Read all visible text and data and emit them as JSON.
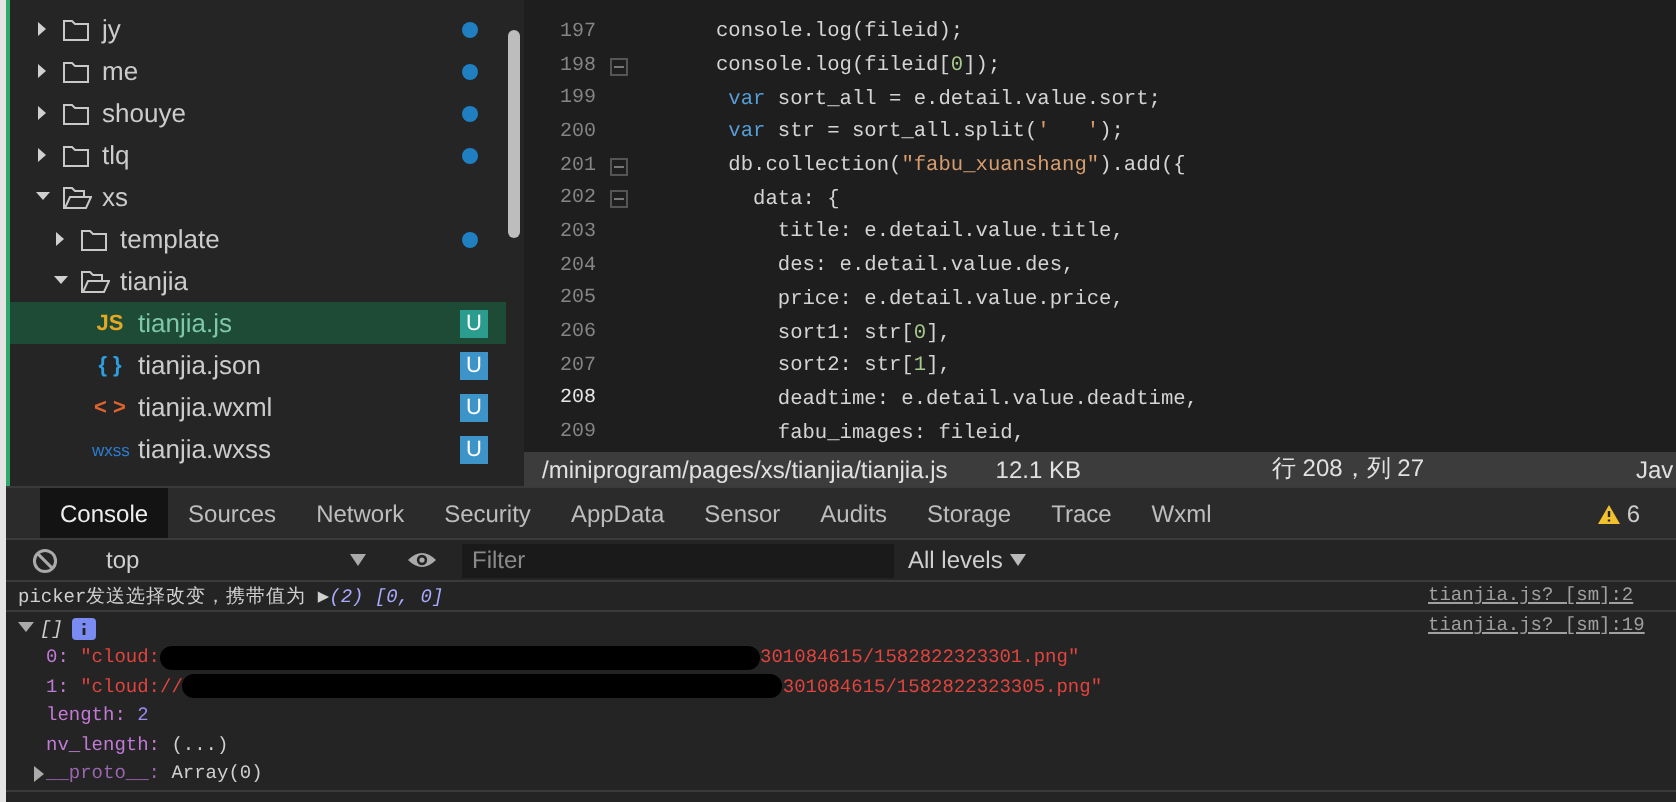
{
  "file_tree": {
    "items": [
      {
        "name": "jy",
        "kind": "folder",
        "expanded": false,
        "modified": true,
        "selected": false
      },
      {
        "name": "me",
        "kind": "folder",
        "expanded": false,
        "modified": true,
        "selected": false
      },
      {
        "name": "shouye",
        "kind": "folder",
        "expanded": false,
        "modified": true,
        "selected": false
      },
      {
        "name": "tlq",
        "kind": "folder",
        "expanded": false,
        "modified": true,
        "selected": false
      },
      {
        "name": "xs",
        "kind": "folder",
        "expanded": true,
        "modified": false,
        "selected": false,
        "children": [
          {
            "name": "template",
            "kind": "folder",
            "expanded": false,
            "modified": true,
            "selected": false
          },
          {
            "name": "tianjia",
            "kind": "folder",
            "expanded": true,
            "modified": false,
            "selected": false,
            "children": [
              {
                "name": "tianjia.js",
                "kind": "js",
                "icon": "JS",
                "badge": "U",
                "selected": true
              },
              {
                "name": "tianjia.json",
                "kind": "json",
                "icon": "{ }",
                "badge": "U",
                "selected": false
              },
              {
                "name": "tianjia.wxml",
                "kind": "wxml",
                "icon": "< >",
                "badge": "U",
                "selected": false
              },
              {
                "name": "tianjia.wxss",
                "kind": "wxss",
                "icon": "wxss",
                "badge": "U",
                "selected": false
              }
            ]
          }
        ]
      }
    ]
  },
  "editor": {
    "lines": [
      {
        "number": "197",
        "fold": false,
        "current": false,
        "tokens": [
          {
            "kind": "plain",
            "text": "console.log(fileid);"
          }
        ]
      },
      {
        "number": "198",
        "fold": true,
        "current": false,
        "tokens": [
          {
            "kind": "plain",
            "text": "console.log(fileid["
          },
          {
            "kind": "number",
            "text": "0"
          },
          {
            "kind": "plain",
            "text": "]);"
          }
        ]
      },
      {
        "number": "199",
        "fold": false,
        "current": false,
        "tokens": [
          {
            "kind": "keyword",
            "text": " var"
          },
          {
            "kind": "plain",
            "text": " sort_all = e.detail.value.sort;"
          }
        ]
      },
      {
        "number": "200",
        "fold": false,
        "current": false,
        "tokens": [
          {
            "kind": "keyword",
            "text": " var"
          },
          {
            "kind": "plain",
            "text": " str = sort_all.split("
          },
          {
            "kind": "string",
            "text": "'   '"
          },
          {
            "kind": "plain",
            "text": ");"
          }
        ]
      },
      {
        "number": "201",
        "fold": true,
        "current": false,
        "tokens": [
          {
            "kind": "plain",
            "text": " db.collection("
          },
          {
            "kind": "string",
            "text": "\"fabu_xuanshang\""
          },
          {
            "kind": "plain",
            "text": ").add({"
          }
        ]
      },
      {
        "number": "202",
        "fold": true,
        "current": false,
        "tokens": [
          {
            "kind": "plain",
            "text": "   data: {"
          }
        ]
      },
      {
        "number": "203",
        "fold": false,
        "current": false,
        "tokens": [
          {
            "kind": "plain",
            "text": "     title: e.detail.value.title,"
          }
        ]
      },
      {
        "number": "204",
        "fold": false,
        "current": false,
        "tokens": [
          {
            "kind": "plain",
            "text": "     des: e.detail.value.des,"
          }
        ]
      },
      {
        "number": "205",
        "fold": false,
        "current": false,
        "tokens": [
          {
            "kind": "plain",
            "text": "     price: e.detail.value.price,"
          }
        ]
      },
      {
        "number": "206",
        "fold": false,
        "current": false,
        "tokens": [
          {
            "kind": "plain",
            "text": "     sort1: str["
          },
          {
            "kind": "number",
            "text": "0"
          },
          {
            "kind": "plain",
            "text": "],"
          }
        ]
      },
      {
        "number": "207",
        "fold": false,
        "current": false,
        "tokens": [
          {
            "kind": "plain",
            "text": "     sort2: str["
          },
          {
            "kind": "number",
            "text": "1"
          },
          {
            "kind": "plain",
            "text": "],"
          }
        ]
      },
      {
        "number": "208",
        "fold": false,
        "current": true,
        "tokens": [
          {
            "kind": "plain",
            "text": "     deadtime: e.detail.value.deadtime,"
          }
        ]
      },
      {
        "number": "209",
        "fold": false,
        "current": false,
        "tokens": [
          {
            "kind": "plain",
            "text": "     fabu_images: fileid,"
          }
        ]
      }
    ],
    "status_bar": {
      "path": "/miniprogram/pages/xs/tianjia/tianjia.js",
      "size": "12.1 KB",
      "position": "行 208，列 27",
      "language": "Jav"
    }
  },
  "devtools": {
    "tabs": [
      {
        "label": "Console",
        "selected": true
      },
      {
        "label": "Sources",
        "selected": false
      },
      {
        "label": "Network",
        "selected": false
      },
      {
        "label": "Security",
        "selected": false
      },
      {
        "label": "AppData",
        "selected": false
      },
      {
        "label": "Sensor",
        "selected": false
      },
      {
        "label": "Audits",
        "selected": false
      },
      {
        "label": "Storage",
        "selected": false
      },
      {
        "label": "Trace",
        "selected": false
      },
      {
        "label": "Wxml",
        "selected": false
      }
    ],
    "warnings": "6",
    "toolbar": {
      "context": "top",
      "filter_placeholder": "Filter",
      "levels": "All levels"
    },
    "messages": [
      {
        "kind": "log",
        "text": "picker发送选择改变，携带值为",
        "expander": "▶",
        "preview": "(2) [0, 0]",
        "source": "tianjia.js? [sm]:2"
      },
      {
        "kind": "array",
        "summary": "[]",
        "expanded": true,
        "source": "tianjia.js? [sm]:19",
        "properties": [
          {
            "kind": "string",
            "key": "0:",
            "value_start": "\"cloud:",
            "redacted": true,
            "value_end": "301084615/1582822323301.png\""
          },
          {
            "kind": "string",
            "key": "1:",
            "value_start": "\"cloud://",
            "redacted": true,
            "value_end": "301084615/1582822323305.png\""
          },
          {
            "kind": "number",
            "key": "length:",
            "value": "2"
          },
          {
            "kind": "getter",
            "key": "nv_length:",
            "value": "(...)"
          },
          {
            "kind": "proto",
            "key": "__proto__:",
            "value": "Array(0)"
          }
        ]
      }
    ]
  }
}
